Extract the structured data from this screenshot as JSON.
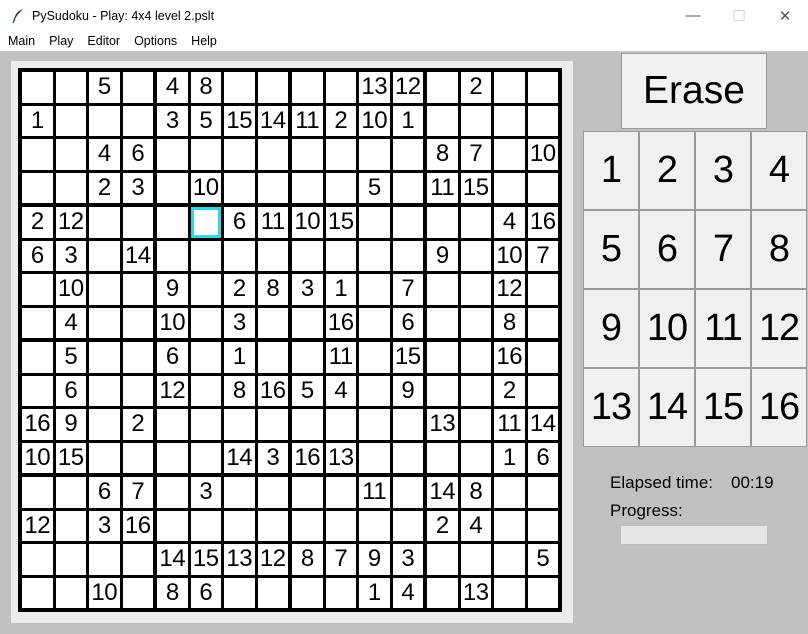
{
  "window": {
    "title": "PySudoku - Play: 4x4 level 2.pslt",
    "minimize": "—",
    "maximize": "☐",
    "close": "✕"
  },
  "menu": [
    "Main",
    "Play",
    "Editor",
    "Options",
    "Help"
  ],
  "board": {
    "size": 16,
    "box": 4,
    "selected": [
      4,
      5
    ],
    "grid": [
      [
        "",
        "",
        "5",
        "",
        "4",
        "8",
        "",
        "",
        "",
        "",
        "13",
        "12",
        "",
        "2",
        "",
        ""
      ],
      [
        "1",
        "",
        "",
        "",
        "3",
        "5",
        "15",
        "14",
        "11",
        "2",
        "10",
        "1",
        "",
        "",
        "",
        ""
      ],
      [
        "",
        "",
        "4",
        "6",
        "",
        "",
        "",
        "",
        "",
        "",
        "",
        "",
        "8",
        "7",
        "",
        "10"
      ],
      [
        "",
        "",
        "2",
        "3",
        "",
        "10",
        "",
        "",
        "",
        "",
        "5",
        "",
        "11",
        "15",
        "",
        ""
      ],
      [
        "2",
        "12",
        "",
        "",
        "",
        "",
        "6",
        "11",
        "10",
        "15",
        "",
        "",
        "",
        "",
        "4",
        "16"
      ],
      [
        "6",
        "3",
        "",
        "14",
        "",
        "",
        "",
        "",
        "",
        "",
        "",
        "",
        "9",
        "",
        "10",
        "7"
      ],
      [
        "",
        "10",
        "",
        "",
        "9",
        "",
        "2",
        "8",
        "3",
        "1",
        "",
        "7",
        "",
        "",
        "12",
        ""
      ],
      [
        "",
        "4",
        "",
        "",
        "10",
        "",
        "3",
        "",
        "",
        "16",
        "",
        "6",
        "",
        "",
        "8",
        ""
      ],
      [
        "",
        "5",
        "",
        "",
        "6",
        "",
        "1",
        "",
        "",
        "11",
        "",
        "15",
        "",
        "",
        "16",
        ""
      ],
      [
        "",
        "6",
        "",
        "",
        "12",
        "",
        "8",
        "16",
        "5",
        "4",
        "",
        "9",
        "",
        "",
        "2",
        ""
      ],
      [
        "16",
        "9",
        "",
        "2",
        "",
        "",
        "",
        "",
        "",
        "",
        "",
        "",
        "13",
        "",
        "11",
        "14"
      ],
      [
        "10",
        "15",
        "",
        "",
        "",
        "",
        "14",
        "3",
        "16",
        "13",
        "",
        "",
        "",
        "",
        "1",
        "6"
      ],
      [
        "",
        "",
        "6",
        "7",
        "",
        "3",
        "",
        "",
        "",
        "",
        "11",
        "",
        "14",
        "8",
        "",
        ""
      ],
      [
        "12",
        "",
        "3",
        "16",
        "",
        "",
        "",
        "",
        "",
        "",
        "",
        "",
        "2",
        "4",
        "",
        ""
      ],
      [
        "",
        "",
        "",
        "",
        "14",
        "15",
        "13",
        "12",
        "8",
        "7",
        "9",
        "3",
        "",
        "",
        "",
        "5"
      ],
      [
        "",
        "",
        "10",
        "",
        "8",
        "6",
        "",
        "",
        "",
        "",
        "1",
        "4",
        "",
        "13",
        "",
        ""
      ]
    ]
  },
  "erase_label": "Erase",
  "number_buttons": [
    "1",
    "2",
    "3",
    "4",
    "5",
    "6",
    "7",
    "8",
    "9",
    "10",
    "11",
    "12",
    "13",
    "14",
    "15",
    "16"
  ],
  "status": {
    "elapsed_label": "Elapsed time:",
    "elapsed_value": "00:19",
    "progress_label": "Progress:",
    "progress_value": 0
  }
}
